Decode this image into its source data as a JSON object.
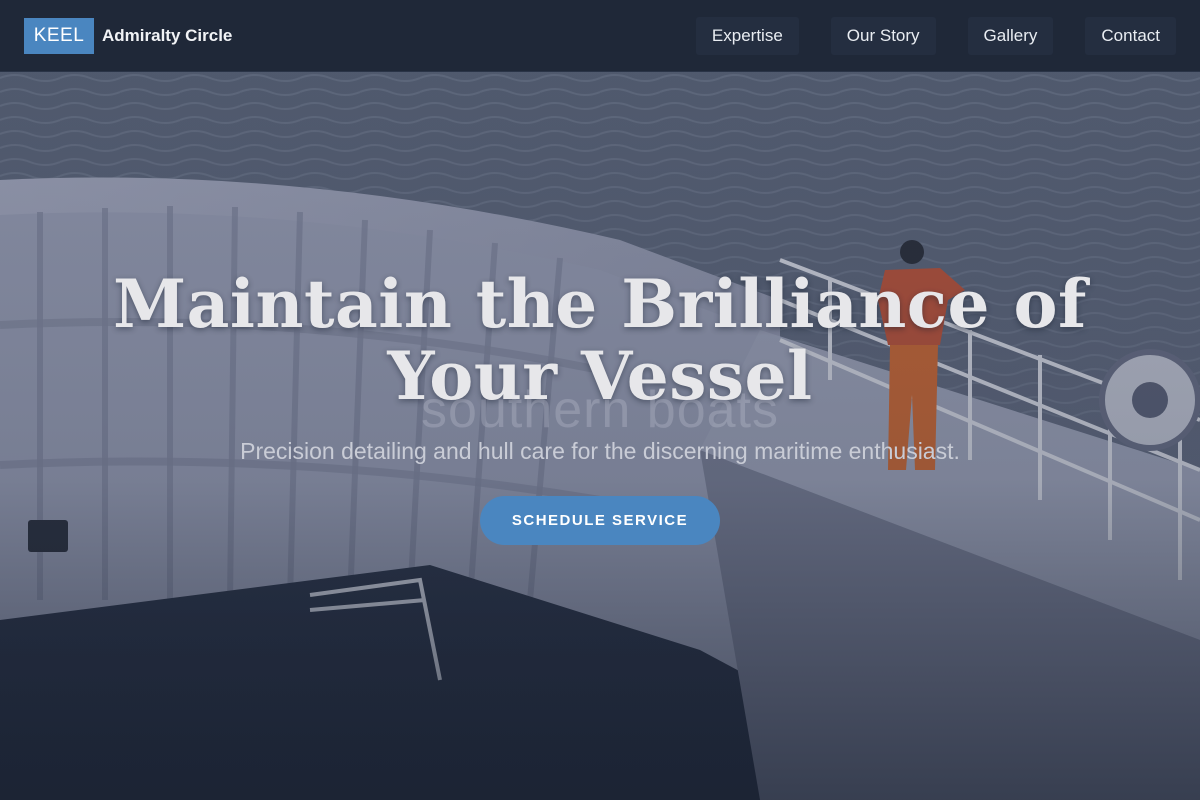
{
  "brand": {
    "badge": "KEEL",
    "name": "Admiralty Circle"
  },
  "nav": {
    "items": [
      {
        "label": "Expertise"
      },
      {
        "label": "Our Story"
      },
      {
        "label": "Gallery"
      },
      {
        "label": "Contact"
      }
    ]
  },
  "hero": {
    "title_line1": "Maintain the Brilliance of",
    "title_line2": "Your Vessel",
    "watermark": "southern boats",
    "subtitle": "Precision detailing and hull care for the discerning maritime enthusiast.",
    "cta_label": "SCHEDULE SERVICE"
  },
  "colors": {
    "accent": "#4a86c0",
    "navbar": "#1f2838",
    "nav_button": "#242e40",
    "text_light": "#e7e7ea"
  }
}
